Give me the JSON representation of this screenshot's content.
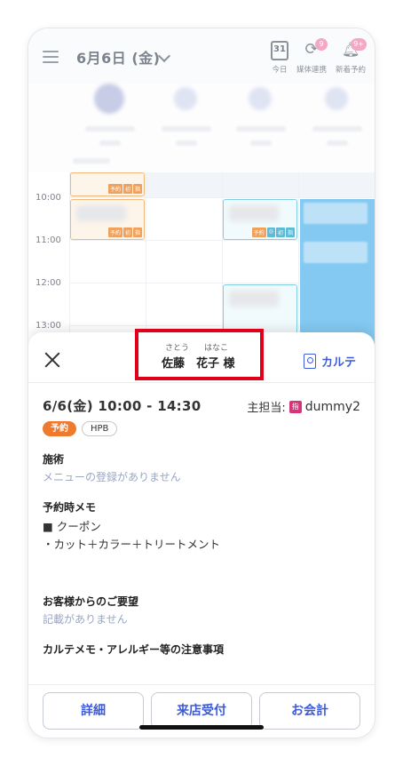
{
  "header": {
    "date_title": "6月6日 (金)",
    "today": {
      "day": "31",
      "label": "今日"
    },
    "media_sync": {
      "label": "媒体連携",
      "badge": "9"
    },
    "new_reservations": {
      "label": "新着予約",
      "badge": "9+"
    }
  },
  "calendar": {
    "hours": [
      "10:00",
      "11:00",
      "12:00",
      "13:00"
    ],
    "tags": {
      "reserve": "予約",
      "first": "初",
      "designated": "指"
    }
  },
  "sheet": {
    "customer": {
      "furigana_last": "さとう",
      "furigana_first": "はなこ",
      "name": "佐藤　花子 様"
    },
    "karte_label": "カルテ",
    "timeslot": "6/6(金) 10:00 - 14:30",
    "main_staff_label": "主担当:",
    "staff_badge": "指",
    "staff_name": "dummy2",
    "pill_reserve": "予約",
    "pill_hpb": "HPB",
    "treatment_title": "施術",
    "treatment_empty": "メニューの登録がありません",
    "memo_title": "予約時メモ",
    "memo_lines": [
      "■ クーポン",
      "・カット＋カラー＋トリートメント"
    ],
    "request_title": "お客様からのご要望",
    "request_empty": "記載がありません",
    "karte_memo_title": "カルテメモ・アレルギー等の注意事項"
  },
  "actions": {
    "detail": "詳細",
    "checkin": "来店受付",
    "checkout": "お会計"
  }
}
